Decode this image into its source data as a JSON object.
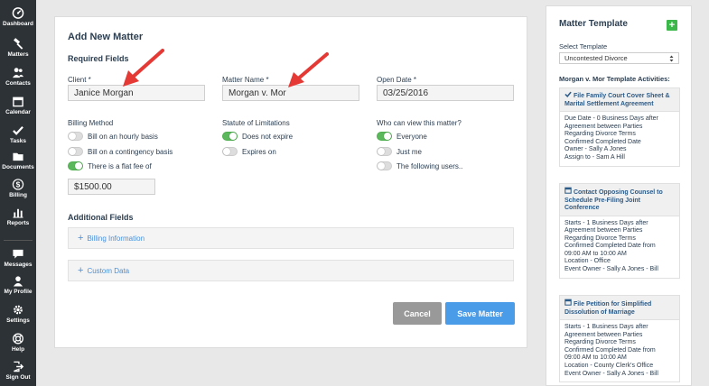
{
  "sidebar": {
    "items": [
      {
        "label": "Dashboard",
        "icon": "dashboard-icon"
      },
      {
        "label": "Matters",
        "icon": "gavel-icon"
      },
      {
        "label": "Contacts",
        "icon": "contacts-icon"
      },
      {
        "label": "Calendar",
        "icon": "calendar-icon"
      },
      {
        "label": "Tasks",
        "icon": "check-icon"
      },
      {
        "label": "Documents",
        "icon": "folder-icon"
      },
      {
        "label": "Billing",
        "icon": "dollar-icon"
      },
      {
        "label": "Reports",
        "icon": "bar-chart-icon"
      },
      {
        "label": "Messages",
        "icon": "chat-icon"
      },
      {
        "label": "My Profile",
        "icon": "user-icon"
      },
      {
        "label": "Settings",
        "icon": "gear-icon"
      },
      {
        "label": "Help",
        "icon": "lifebuoy-icon"
      },
      {
        "label": "Sign Out",
        "icon": "sign-out-icon"
      }
    ]
  },
  "form": {
    "title": "Add New Matter",
    "required_heading": "Required Fields",
    "client_label": "Client *",
    "client_value": "Janice Morgan",
    "matter_name_label": "Matter Name *",
    "matter_name_value": "Morgan v. Mor",
    "open_date_label": "Open Date *",
    "open_date_value": "03/25/2016",
    "billing": {
      "label": "Billing Method",
      "options": [
        {
          "text": "Bill on an hourly basis",
          "on": false
        },
        {
          "text": "Bill on a contingency basis",
          "on": false
        },
        {
          "text": "There is a flat fee of",
          "on": true
        }
      ],
      "flat_fee_value": "$1500.00"
    },
    "statute": {
      "label": "Statute of Limitations",
      "options": [
        {
          "text": "Does not expire",
          "on": true
        },
        {
          "text": "Expires on",
          "on": false
        }
      ]
    },
    "visibility": {
      "label": "Who can view this matter?",
      "options": [
        {
          "text": "Everyone",
          "on": true
        },
        {
          "text": "Just me",
          "on": false
        },
        {
          "text": "The following users..",
          "on": false
        }
      ]
    },
    "additional_heading": "Additional Fields",
    "billing_info_label": "Billing Information",
    "custom_data_label": "Custom Data",
    "cancel_label": "Cancel",
    "save_label": "Save Matter"
  },
  "template_panel": {
    "title": "Matter Template",
    "add_symbol": "+",
    "select_label": "Select Template",
    "selected_template": "Uncontested Divorce",
    "activities_heading": "Morgan v. Mor Template Activities:",
    "activities": [
      {
        "icon": "check-icon",
        "title": "File Family Court Cover Sheet & Marital Settlement Agreement",
        "lines": [
          "Due Date - 0 Business Days after",
          "Agreement between Parties",
          "Regarding Divorce Terms",
          "Confirmed Completed Date",
          "Owner - Sally A Jones",
          "Assign to - Sam A Hill"
        ]
      },
      {
        "icon": "calendar-icon",
        "title": "Contact Opposing Counsel to Schedule Pre-Filing Joint Conference",
        "lines": [
          "Starts - 1 Business Days after",
          "Agreement between Parties",
          "Regarding Divorce Terms",
          "Confirmed Completed Date from",
          "09:00 AM to 10:00 AM",
          "Location - Office",
          "Event Owner - Sally A Jones - Bill"
        ]
      },
      {
        "icon": "calendar-icon",
        "title": "File Petition for Simplified Dissolution of Marriage",
        "lines": [
          "Starts - 1 Business Days after",
          "Agreement between Parties",
          "Regarding Divorce Terms",
          "Confirmed Completed Date from",
          "09:00 AM to 10:00 AM",
          "Location - County Clerk's Office",
          "Event Owner - Sally A Jones - Bill"
        ]
      }
    ]
  },
  "colors": {
    "sidebar_bg": "#2d3236",
    "toggle_on": "#5cb85c",
    "accent_blue": "#4a9be8",
    "cancel_gray": "#999999",
    "add_green": "#3cb84a",
    "annotation_arrow": "#e53935"
  }
}
